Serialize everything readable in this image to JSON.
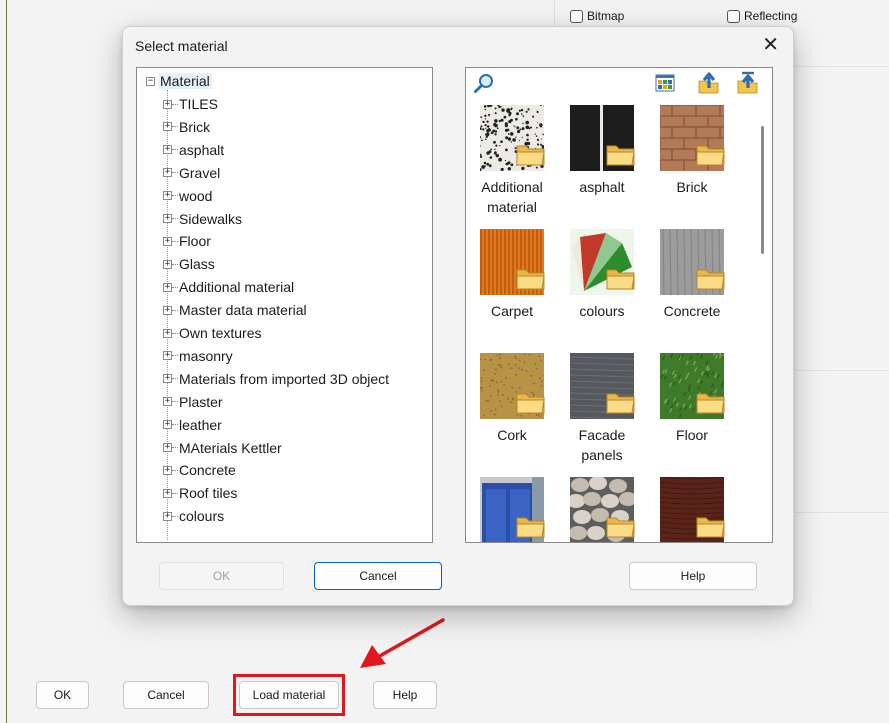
{
  "background": {
    "checkboxes": [
      {
        "label": "Bitmap",
        "checked": false
      },
      {
        "label": "Reflecting",
        "checked": false
      }
    ],
    "buttons": {
      "ok": "OK",
      "cancel": "Cancel",
      "load_material": "Load material",
      "help": "Help"
    },
    "colors": {
      "highlight": "#e0181e",
      "arrow": "#e0181e"
    }
  },
  "dialog": {
    "title": "Select material",
    "close_glyph": "✕",
    "tree": {
      "root": "Material",
      "items": [
        "TILES",
        "Brick",
        "asphalt",
        "Gravel",
        "wood",
        "Sidewalks",
        "Floor",
        "Glass",
        "Additional material",
        "Master data material",
        "Own textures",
        "masonry",
        "Materials from imported 3D object",
        "Plaster",
        "leather",
        "MAterials Kettler",
        "Concrete",
        "Roof tiles",
        "colours"
      ]
    },
    "toolbar": {
      "icons": [
        "search-icon",
        "view-grid-icon",
        "folder-up-icon",
        "folder-top-icon"
      ]
    },
    "tiles": [
      {
        "label": "Additional material",
        "texture": "speckled-white"
      },
      {
        "label": "asphalt",
        "texture": "dark"
      },
      {
        "label": "Brick",
        "texture": "brick"
      },
      {
        "label": "Carpet",
        "texture": "orange-stripes"
      },
      {
        "label": "colours",
        "texture": "color-fan"
      },
      {
        "label": "Concrete",
        "texture": "grey-wood"
      },
      {
        "label": "Cork",
        "texture": "cork"
      },
      {
        "label": "Facade panels",
        "texture": "slate"
      },
      {
        "label": "Floor",
        "texture": "grass"
      },
      {
        "label": "",
        "texture": "glass"
      },
      {
        "label": "",
        "texture": "stones"
      },
      {
        "label": "",
        "texture": "leather"
      }
    ],
    "buttons": {
      "ok": "OK",
      "cancel": "Cancel",
      "help": "Help"
    }
  }
}
